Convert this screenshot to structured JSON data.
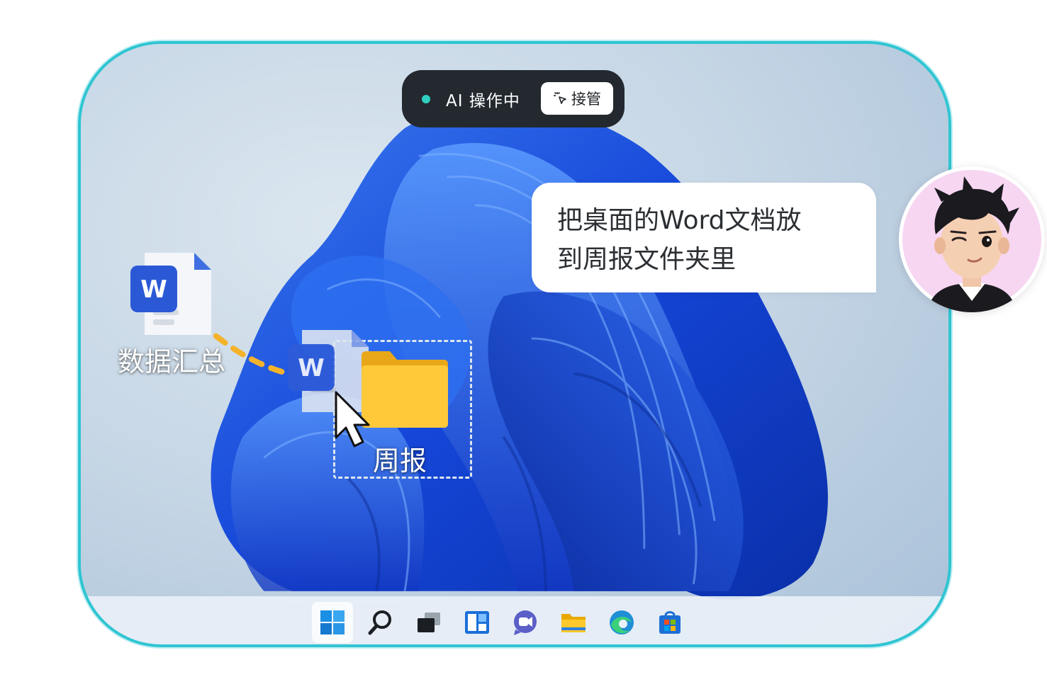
{
  "window": {
    "accent_color": "#2fc5d2"
  },
  "status_bar": {
    "text": "AI 操作中",
    "dot_color": "#2fd0c0",
    "takeover_label": "接管",
    "takeover_icon": "cursor-click-icon"
  },
  "chat_bubble": {
    "line1": "把桌面的Word文档放",
    "line2": "到周报文件夹里"
  },
  "avatar": {
    "icon": "user-avatar-icon"
  },
  "desktop": {
    "files": [
      {
        "label": "数据汇总",
        "icon": "word-document-icon"
      },
      {
        "label": "周报",
        "icon": "folder-icon"
      }
    ],
    "dragging": {
      "icon": "word-document-icon"
    }
  },
  "taskbar": {
    "items": [
      {
        "icon": "windows-start-icon"
      },
      {
        "icon": "search-icon"
      },
      {
        "icon": "task-view-icon"
      },
      {
        "icon": "widgets-icon"
      },
      {
        "icon": "teams-chat-icon"
      },
      {
        "icon": "file-explorer-icon"
      },
      {
        "icon": "edge-browser-icon"
      },
      {
        "icon": "microsoft-store-icon"
      }
    ]
  }
}
